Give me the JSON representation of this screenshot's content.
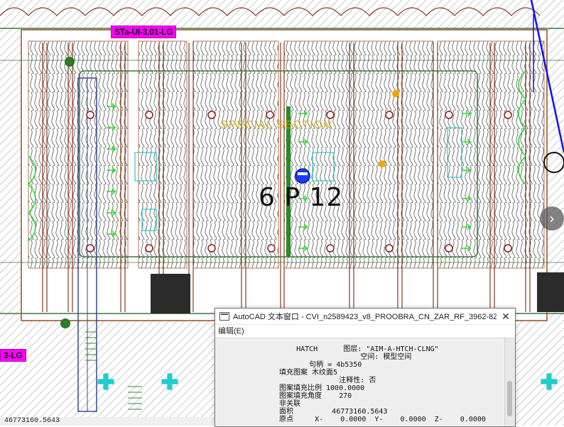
{
  "drawing": {
    "tags": {
      "left_top": "STa-UI-3.01-LG",
      "left_bottom": "3-LG"
    },
    "room_label": "6 P 12",
    "section_label": "SPECIAL SECTION",
    "nav_arrow": "›"
  },
  "text_window": {
    "title": "AutoCAD 文本窗口 - CVI_n2589423_v8_PROOBRA_CN_ZAR_RF_3962-8Z-...",
    "close": "✕",
    "menu_edit": "编辑(E)",
    "lines": [
      "    HATCH      图层: \"AIM-A-HTCH-CLNG\"",
      "                   空间: 模型空间",
      "       句柄 = 4b5350",
      "填充图案 木纹面5",
      "              注释性: 否",
      "图案填充比例 1000.0000",
      "图案填充角度    270",
      "非关联",
      "面积         46773160.5643",
      "原点     X-    0.0000  Y-    0.0000  Z-    0.0000"
    ]
  },
  "status": {
    "area_readout": "46773160.5643"
  },
  "colors": {
    "magenta_tag": "#ff00ff",
    "wood_stripe": "#7b3a1f",
    "green_symbol": "#22dd22",
    "cyan_symbol": "#22cccc",
    "arrow_red": "#e84a3a"
  }
}
